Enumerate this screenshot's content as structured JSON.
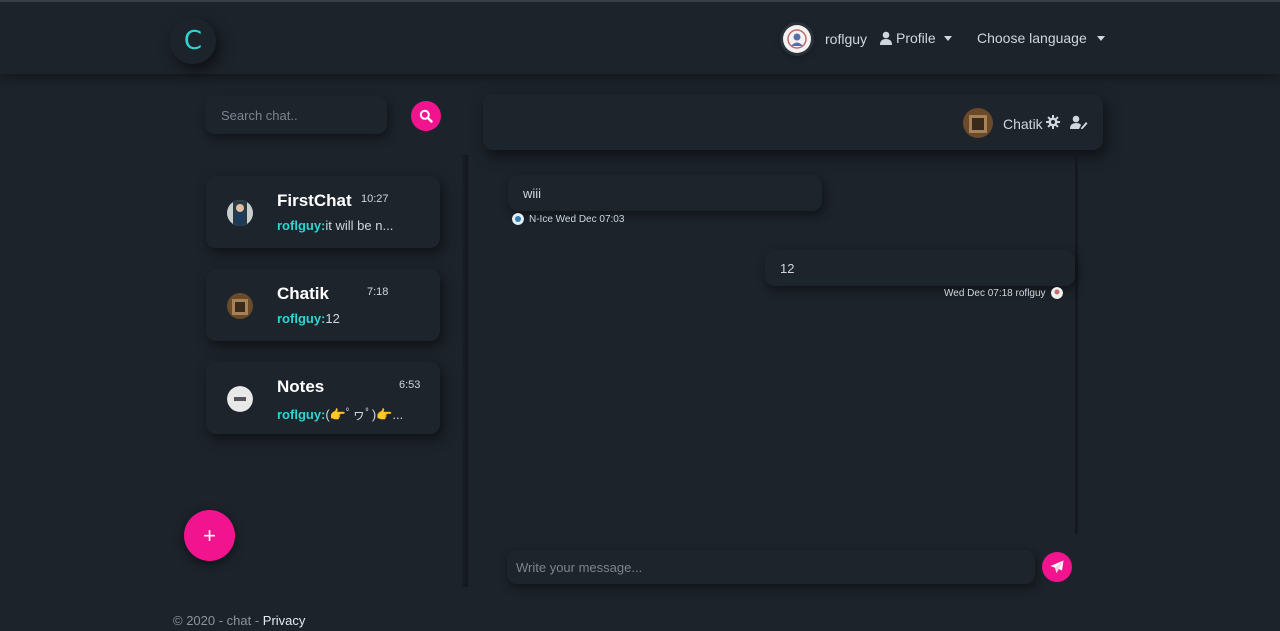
{
  "brand": {
    "logo_letter": "C"
  },
  "navbar": {
    "username": "roflguy",
    "profile_label": "Profile",
    "language_label": "Choose language"
  },
  "sidebar": {
    "search_placeholder": "Search chat..",
    "chats": [
      {
        "name": "FirstChat",
        "time": "10:27",
        "author": "roflguy:",
        "message": "it will be n..."
      },
      {
        "name": "Chatik",
        "time": "7:18",
        "author": "roflguy:",
        "message": "12"
      },
      {
        "name": "Notes",
        "time": "6:53",
        "author": "roflguy:",
        "message": "(👉ﾟヮﾟ)👉..."
      }
    ],
    "add_button_label": "+"
  },
  "chat": {
    "title": "Chatik",
    "messages": [
      {
        "text": "wiii",
        "meta": "N-Ice Wed Dec 07:03",
        "side": "left"
      },
      {
        "text": "12",
        "meta": "Wed Dec 07:18 roflguy",
        "side": "right"
      }
    ],
    "composer_placeholder": "Write your message..."
  },
  "footer": {
    "copyright": "© 2020 - chat - ",
    "privacy_label": "Privacy"
  },
  "colors": {
    "background": "#1d232b",
    "accent_pink": "#f2138f",
    "accent_cyan": "#2fd4d2"
  }
}
